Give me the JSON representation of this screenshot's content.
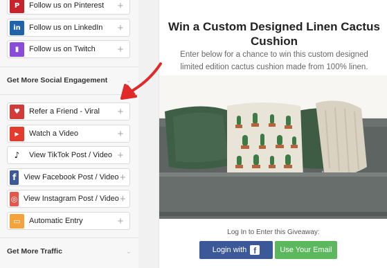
{
  "sidebar": {
    "entries_top": [
      {
        "label": "Follow us on Pinterest",
        "icon": "pinterest-icon",
        "glyph": "P",
        "color": "#c8232c"
      },
      {
        "label": "Follow us on LinkedIn",
        "icon": "linkedin-icon",
        "glyph": "in",
        "color": "#1f64a8"
      },
      {
        "label": "Follow us on Twitch",
        "icon": "twitch-icon",
        "glyph": "▮",
        "color": "#8a4bd8"
      }
    ],
    "section_social": "Get More Social Engagement",
    "entries_social": [
      {
        "label": "Refer a Friend - Viral",
        "icon": "heart-icon",
        "glyph": "♥",
        "color": "#d33a3a"
      },
      {
        "label": "Watch a Video",
        "icon": "youtube-icon",
        "glyph": "▶",
        "color": "#e53b2c"
      },
      {
        "label": "View TikTok Post / Video",
        "icon": "tiktok-icon",
        "glyph": "♪",
        "color": "#ffffff"
      },
      {
        "label": "View Facebook Post / Video",
        "icon": "facebook-icon",
        "glyph": "f",
        "color": "#3b5998"
      },
      {
        "label": "View Instagram Post / Video",
        "icon": "instagram-icon",
        "glyph": "◎",
        "color": "#e4574a"
      },
      {
        "label": "Automatic Entry",
        "icon": "automatic-entry-icon",
        "glyph": "▭",
        "color": "#f6a23a"
      }
    ],
    "section_traffic": "Get More Traffic",
    "plus_glyph": "+",
    "chevron_glyph": "⌄"
  },
  "preview": {
    "title": "Win a Custom Designed Linen Cactus Cushion",
    "description": "Enter below for a chance to win this custom designed limited edition cactus cushion made from 100% linen.",
    "login_label": "Log In to Enter this Giveaway:",
    "login_button": "Login with",
    "email_button": "Use Your Email",
    "fb_glyph": "f"
  },
  "annotation": {
    "color": "#e02a2a"
  }
}
